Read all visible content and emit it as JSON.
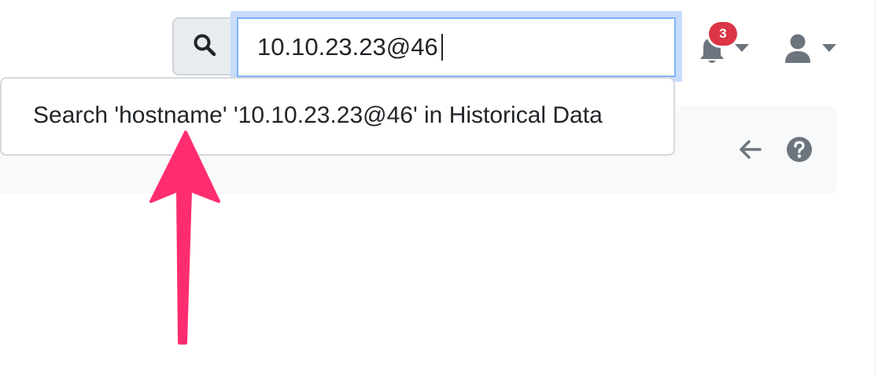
{
  "search": {
    "value": "10.10.23.23@46",
    "icon": "search-icon"
  },
  "suggestion": {
    "label": "Search 'hostname' '10.10.23.23@46' in Historical Data"
  },
  "notifications": {
    "icon": "bell-icon",
    "count": "3"
  },
  "user_menu": {
    "icon": "user-icon"
  },
  "toolbar": {
    "back_icon": "arrow-left-icon",
    "help_icon": "question-circle-icon"
  },
  "annotation": {
    "icon": "pointer-arrow",
    "color": "#ff2d6f"
  },
  "colors": {
    "badge": "#dc3545",
    "focus": "#80b3f6",
    "icon_gray": "#6c757d"
  }
}
